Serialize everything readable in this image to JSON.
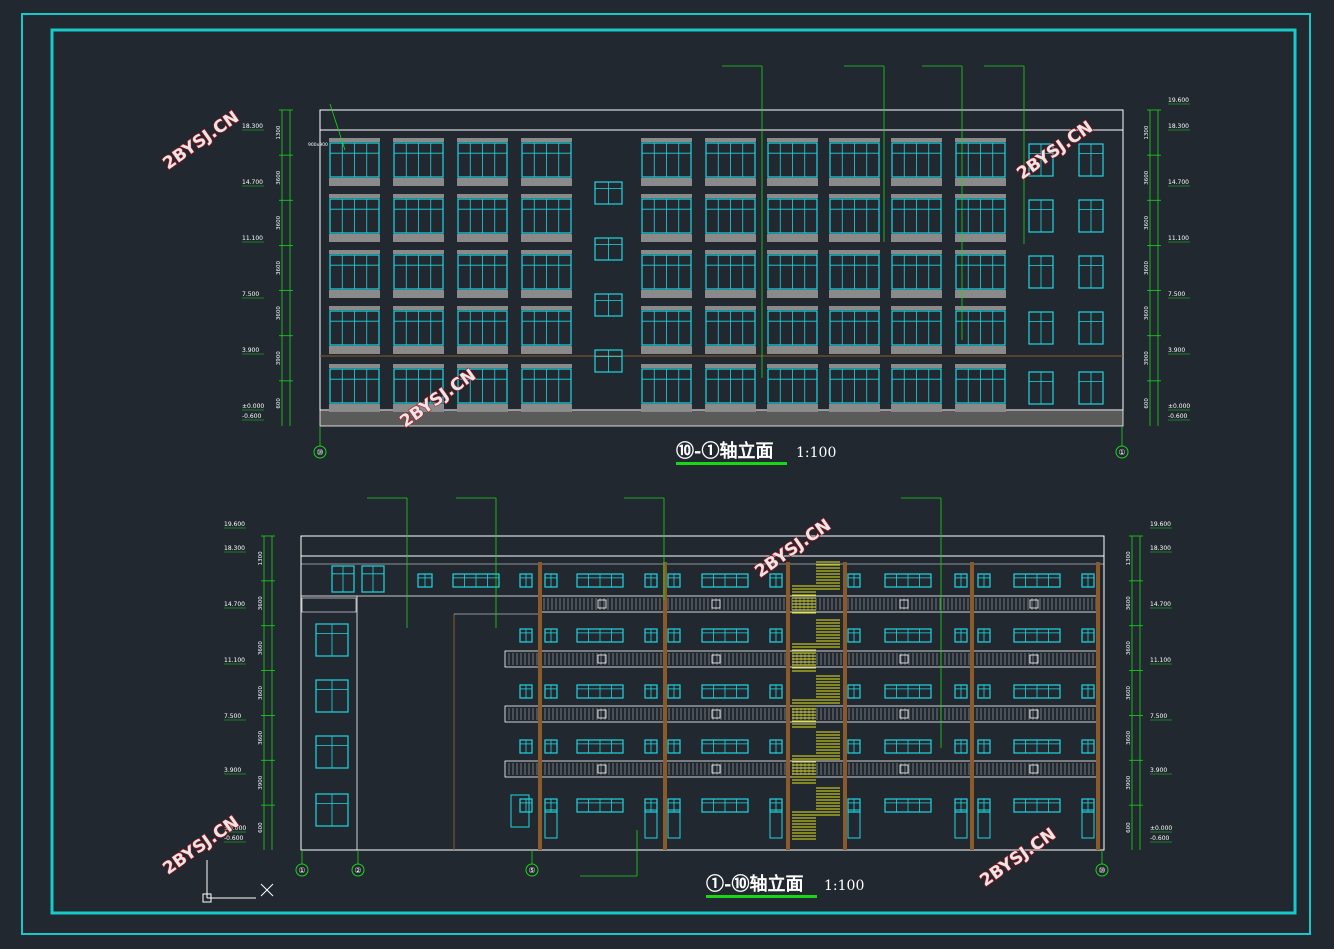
{
  "colors": {
    "background": "#212830",
    "frame": "#19c9c9",
    "window": "#1fd6e0",
    "green": "#19d619",
    "wall": "#ffffff",
    "band": "#8a8a8a",
    "stair": "#e6e619",
    "brown": "#8a5a2a"
  },
  "watermark": "2BYSJ.CN",
  "upper_elevation": {
    "title": "⑩-①轴立面",
    "scale": "1:100",
    "axis_left": "⑩",
    "axis_right": "①",
    "elevations_left": [
      "18.300",
      "14.700",
      "11.100",
      "7.500",
      "3.900",
      "±0.000",
      "-0.600"
    ],
    "elevations_right": [
      "19.600",
      "18.300",
      "14.700",
      "11.100",
      "7.500",
      "3.900",
      "±0.000",
      "-0.600"
    ],
    "dims_left": [
      "1300",
      "3600",
      "3600",
      "3600",
      "3600",
      "3900",
      "600"
    ],
    "dims_right": [
      "1300",
      "3600",
      "3600",
      "3600",
      "3600",
      "3900",
      "600"
    ],
    "window_tag": "900x900"
  },
  "lower_elevation": {
    "title": "①-⑩轴立面",
    "scale": "1:100",
    "axis_labels": [
      "①",
      "②",
      "⑤",
      "⑩"
    ],
    "elevations_left": [
      "19.600",
      "18.300",
      "14.700",
      "11.100",
      "7.500",
      "3.900",
      "±0.000",
      "-0.600"
    ],
    "elevations_right": [
      "19.600",
      "18.300",
      "14.700",
      "11.100",
      "7.500",
      "3.900",
      "±0.000",
      "-0.600"
    ],
    "dims_left": [
      "1300",
      "3600",
      "3600",
      "3600",
      "3600",
      "3900",
      "600"
    ],
    "dims_right": [
      "1300",
      "3600",
      "3600",
      "3600",
      "3600",
      "3900",
      "600"
    ]
  }
}
